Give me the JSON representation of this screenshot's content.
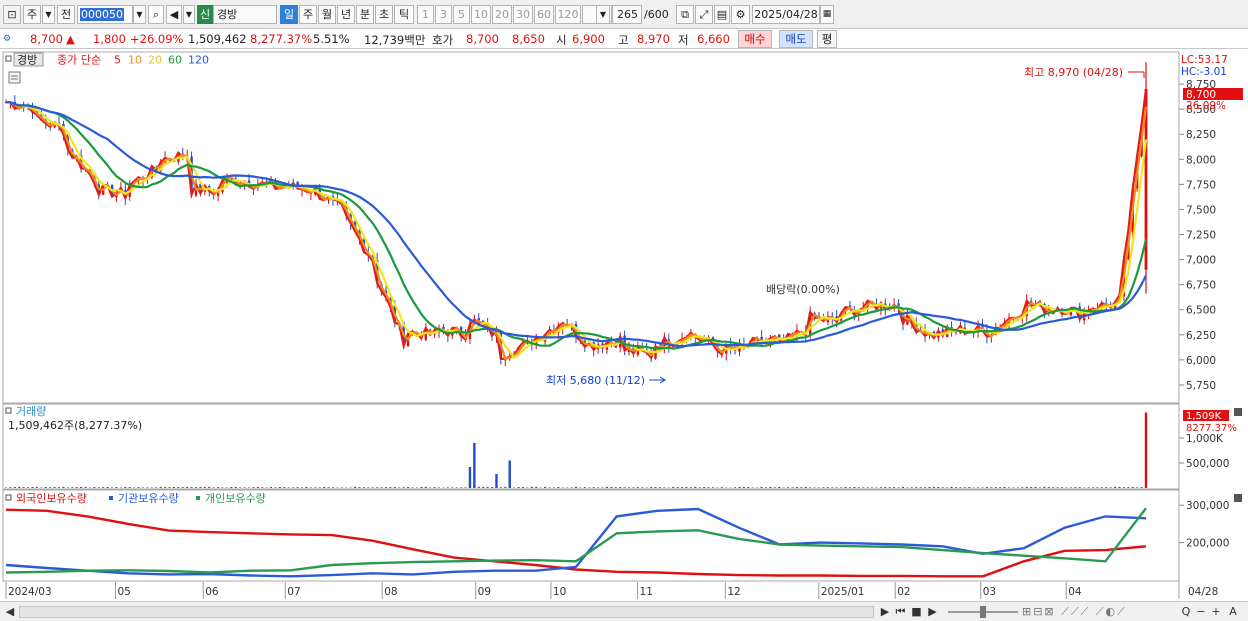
{
  "toolbar": {
    "period_label": "주",
    "prev_label": "전",
    "code": "000050",
    "new_badge": "신",
    "stock_name": "경방",
    "periods": [
      "일",
      "주",
      "월",
      "년",
      "분",
      "초",
      "틱"
    ],
    "intervals": [
      "1",
      "3",
      "5",
      "10",
      "20",
      "30",
      "60",
      "120"
    ],
    "count": "265",
    "count_total": "/600",
    "date": "2025/04/28"
  },
  "quote": {
    "price": "8,700",
    "change_arrow": "▲",
    "change": "1,800",
    "change_pct": "+26.09%",
    "volume": "1,509,462",
    "volume_pct": "8,277.37%",
    "turnover": "5.51%",
    "amount": "12,739백만",
    "bid_label": "호가",
    "ask": "8,700",
    "bid": "8,650",
    "open_label": "시",
    "open": "6,900",
    "high_label": "고",
    "high": "8,970",
    "low_label": "저",
    "low": "6,660",
    "buy_label": "매수",
    "sell_label": "매도",
    "eval_label": "평"
  },
  "legend": {
    "name": "경방",
    "ma_title": "종가 단순",
    "ma_periods": [
      "5",
      "10",
      "20",
      "60",
      "120"
    ]
  },
  "annotations": {
    "high": "최고 8,970 (04/28)",
    "low": "최저 5,680 (11/12)",
    "dividend": "배당락(0.00%)",
    "lc": "LC:53.17",
    "hc": "HC:-3.01",
    "price_tag": "8,700",
    "pct_tag": "26.09%",
    "volume_title": "거래량",
    "volume_info": "1,509,462주(8,277.37%)",
    "volume_tag": "1,509K",
    "volume_pct_tag": "8277.37%",
    "holdings_titles": [
      "외국인보유수량",
      "기관보유수량",
      "개인보유수량"
    ]
  },
  "scrollbar": {
    "buttons": [
      "▶",
      "⏮",
      "■",
      "▶",
      "◀",
      "Q",
      "−",
      "+",
      "A"
    ]
  },
  "chart_data": {
    "type": "candlestick",
    "price_axis": {
      "ticks": [
        5750,
        6000,
        6250,
        6500,
        6750,
        7000,
        7250,
        7500,
        7750,
        8000,
        8250,
        8500,
        8750
      ],
      "tick_labels": [
        "5,750",
        "6,000",
        "6,250",
        "6,500",
        "6,750",
        "7,000",
        "7,250",
        "7,500",
        "7,750",
        "8,000",
        "8,250",
        "8,500",
        "8,750"
      ],
      "range": [
        5600,
        9050
      ]
    },
    "x_axis": {
      "labels": [
        "2024/03",
        "05",
        "06",
        "07",
        "08",
        "09",
        "10",
        "11",
        "12",
        "2025/01",
        "02",
        "03",
        "04"
      ],
      "right_label": "04/28"
    },
    "close_profile": [
      [
        8570,
        8520
      ],
      [
        8400,
        8300
      ],
      [
        8100,
        7800
      ],
      [
        7700,
        7650
      ],
      [
        7750,
        7900
      ],
      [
        8000,
        8050
      ],
      [
        7700,
        7680
      ],
      [
        7800,
        7780
      ],
      [
        7760,
        7720
      ],
      [
        7730,
        7700
      ],
      [
        7680,
        7500
      ],
      [
        7400,
        7000
      ],
      [
        6800,
        6200
      ],
      [
        6280,
        6250
      ],
      [
        6300,
        6260
      ],
      [
        6400,
        6250
      ],
      [
        6050,
        6150
      ],
      [
        6200,
        6350
      ],
      [
        6400,
        6150
      ],
      [
        6150,
        6200
      ],
      [
        6100,
        6050
      ],
      [
        6150,
        6230
      ],
      [
        6280,
        6150
      ],
      [
        6100,
        6100
      ],
      [
        6150,
        6200
      ],
      [
        6150,
        6300
      ],
      [
        6420,
        6380
      ],
      [
        6470,
        6530
      ],
      [
        6550,
        6540
      ],
      [
        6420,
        6250
      ],
      [
        6250,
        6300
      ],
      [
        6300,
        6280
      ],
      [
        6320,
        6500
      ],
      [
        6560,
        6500
      ],
      [
        6530,
        6450
      ],
      [
        6520,
        6560
      ],
      [
        6600,
        8700
      ]
    ],
    "ma_series": [
      {
        "name": "5",
        "color": "#e51a1a"
      },
      {
        "name": "10",
        "color": "#f08c1c"
      },
      {
        "name": "20",
        "color": "#f0e61e"
      },
      {
        "name": "60",
        "color": "#1a9a3a"
      },
      {
        "name": "120",
        "color": "#2a5ad8"
      }
    ],
    "high": {
      "value": 8970,
      "date": "04/28"
    },
    "low": {
      "value": 5680,
      "date": "11/12"
    },
    "volume_axis": {
      "ticks": [
        500000,
        1000000
      ],
      "tick_labels": [
        "500,000",
        "1,000K"
      ],
      "range": [
        0,
        1600000
      ]
    },
    "volume_spikes": [
      {
        "value": 420000
      },
      {
        "value": 900000
      },
      {
        "value": 280000
      },
      {
        "value": 550000
      },
      {
        "value": 1509462
      }
    ],
    "holdings_axis": {
      "ticks": [
        200000,
        300000
      ],
      "tick_labels": [
        "200,000",
        "300,000"
      ],
      "range": [
        100000,
        330000
      ]
    },
    "holdings": [
      {
        "name": "외국인보유수량",
        "color": "#e01010",
        "values": [
          288000,
          285000,
          270000,
          250000,
          232000,
          228000,
          225000,
          222000,
          220000,
          205000,
          182000,
          160000,
          150000,
          140000,
          128000,
          122000,
          120000,
          116000,
          113000,
          112000,
          112000,
          111000,
          111000,
          110000,
          110000,
          150000,
          178000,
          180000,
          190000
        ]
      },
      {
        "name": "기관보유수량",
        "color": "#2a5ad8",
        "values": [
          140000,
          132000,
          125000,
          118000,
          115000,
          116000,
          112000,
          110000,
          113000,
          118000,
          115000,
          122000,
          125000,
          125000,
          135000,
          270000,
          285000,
          290000,
          240000,
          195000,
          200000,
          198000,
          195000,
          190000,
          170000,
          185000,
          240000,
          270000,
          265000
        ]
      },
      {
        "name": "개인보유수량",
        "color": "#2a9a52",
        "values": [
          120000,
          122000,
          125000,
          126000,
          124000,
          120000,
          125000,
          126000,
          140000,
          145000,
          148000,
          150000,
          152000,
          153000,
          150000,
          225000,
          230000,
          233000,
          210000,
          195000,
          192000,
          190000,
          188000,
          180000,
          172000,
          165000,
          158000,
          150000,
          292000
        ]
      }
    ]
  }
}
